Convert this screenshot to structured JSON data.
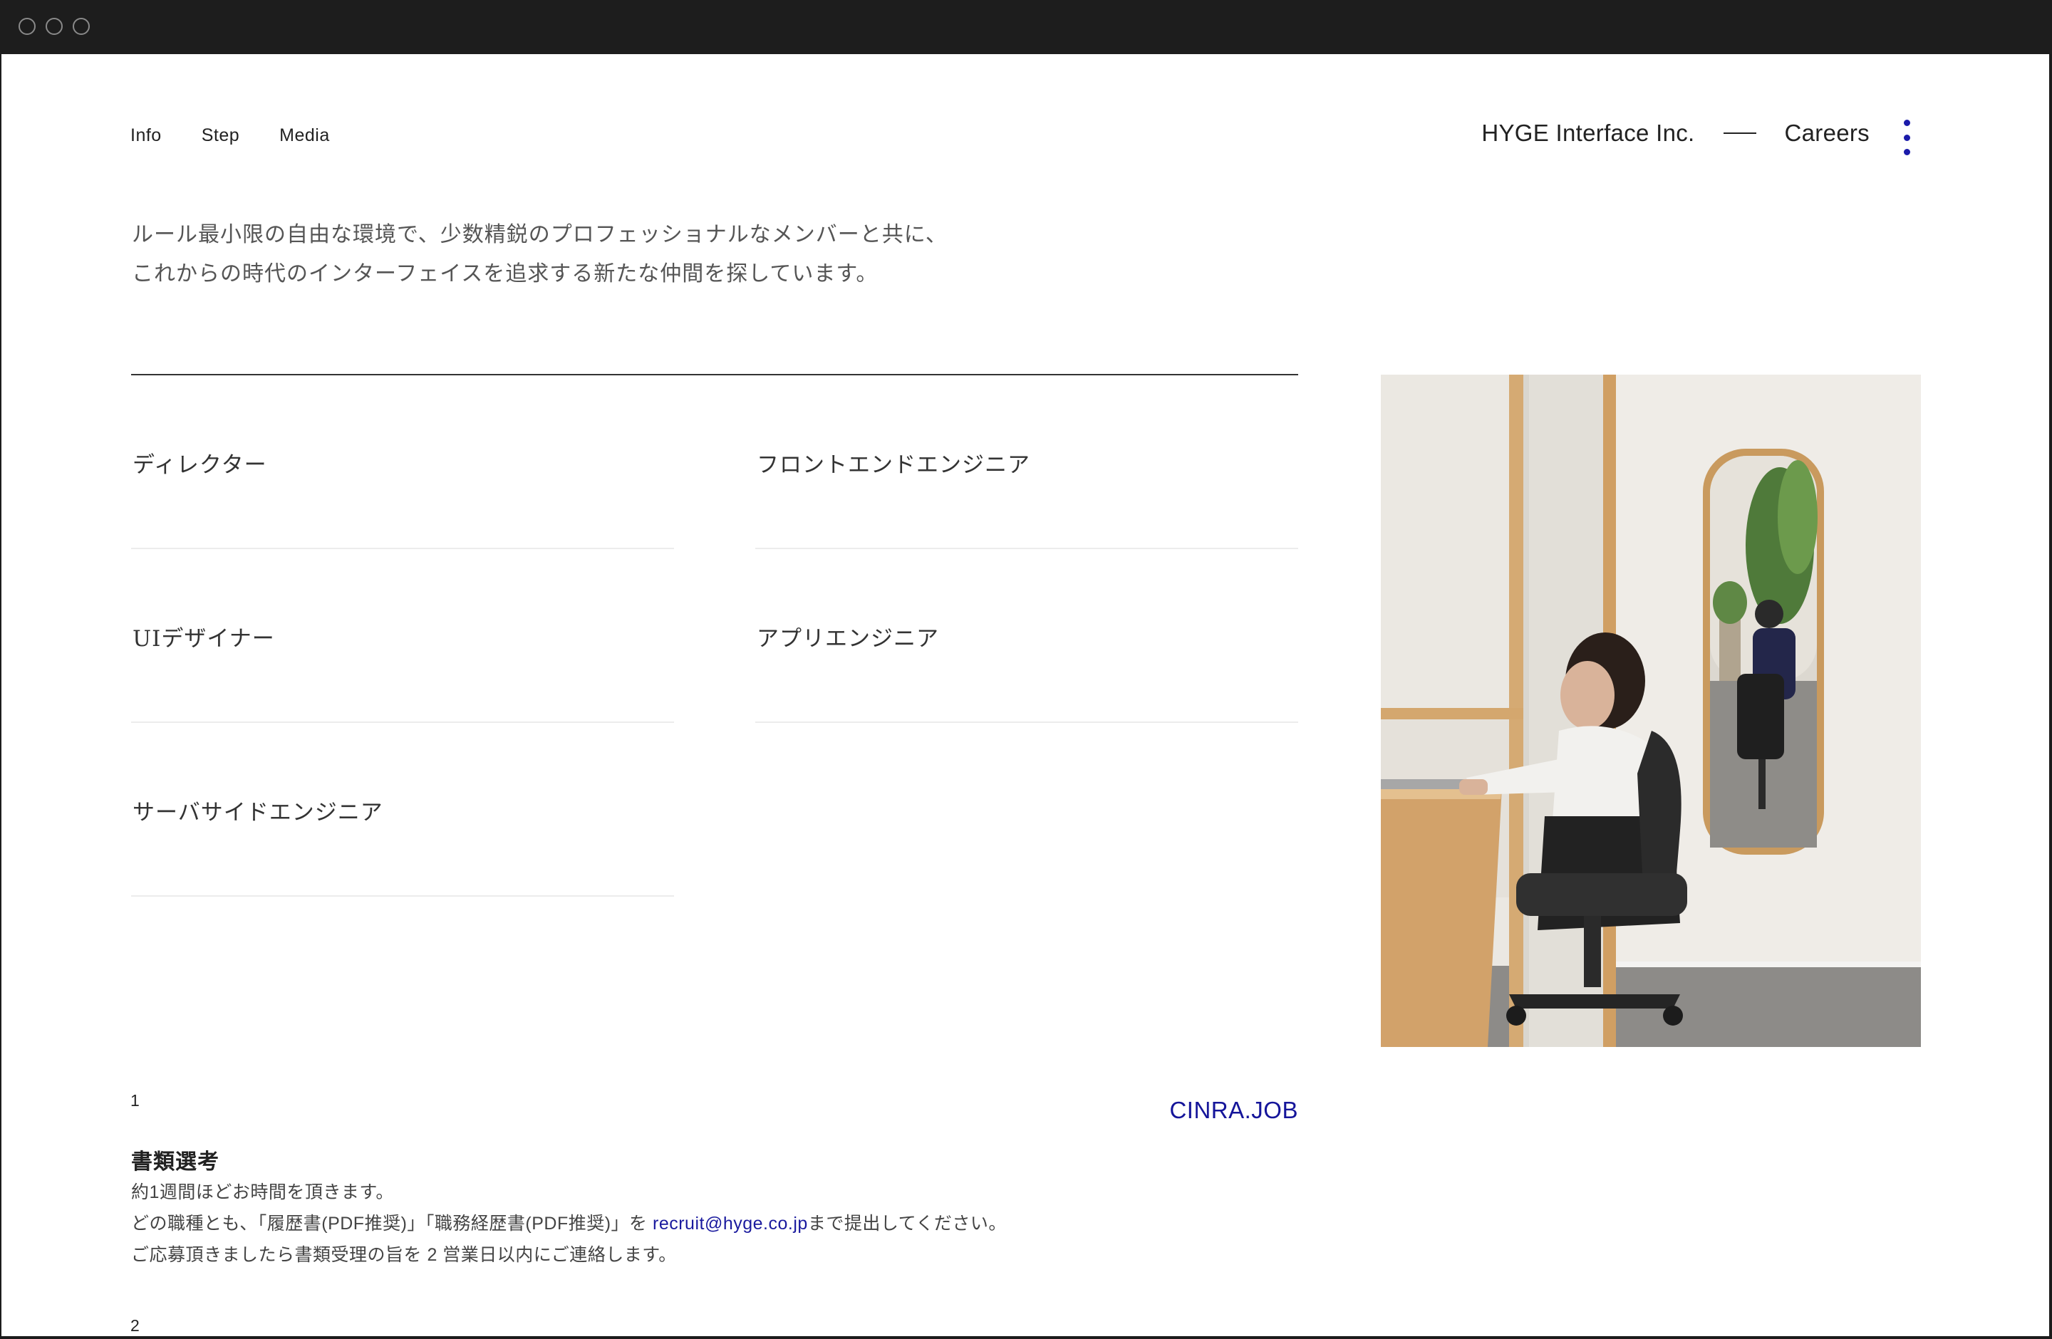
{
  "nav": {
    "links": [
      "Info",
      "Step",
      "Media"
    ]
  },
  "header": {
    "company": "HYGE Interface Inc.",
    "section": "Careers"
  },
  "intro": {
    "line1": "ルール最小限の自由な環境で、少数精鋭のプロフェッショナルなメンバーと共に、",
    "line2": "これからの時代のインターフェイスを追求する新たな仲間を探しています。"
  },
  "jobs": [
    "ディレクター",
    "フロントエンドエンジニア",
    "UIデザイナー",
    "アプリエンジニア",
    "サーバサイドエンジニア"
  ],
  "external_link": "CINRA.JOB",
  "steps": [
    {
      "number": "1",
      "title": "書類選考",
      "line1": "約1週間ほどお時間を頂きます。",
      "line2_before": "どの職種とも、「履歴書(PDF推奨)」「職務経歴書(PDF推奨)」を ",
      "email": "recruit@hyge.co.jp",
      "line2_after": "まで提出してください。",
      "line3": "ご応募頂きましたら書類受理の旨を 2 営業日以内にご連絡します。"
    },
    {
      "number": "2"
    }
  ],
  "colors": {
    "accent": "#15159a",
    "titlebar": "#1d1d1d"
  }
}
